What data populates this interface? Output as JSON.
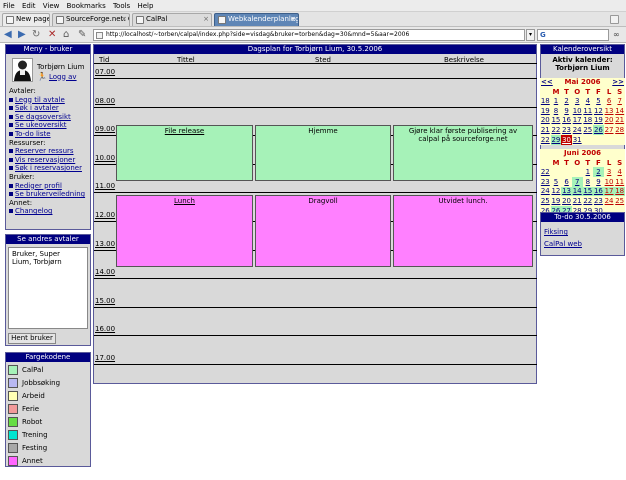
{
  "menu": [
    "File",
    "Edit",
    "View",
    "Bookmarks",
    "Tools",
    "Help"
  ],
  "tabs": [
    {
      "label": "New page"
    },
    {
      "label": "SourceForge.net: Cal..."
    },
    {
      "label": "CalPal"
    },
    {
      "label": "Webkalenderplanleg..."
    }
  ],
  "url": "http://localhost/~torben/calpal/index.php?side=visdag&bruker=torben&dag=30&mnd=5&aar=2006",
  "search_prefix": "G",
  "left": {
    "meny_title": "Meny - bruker",
    "user_name": "Torbjørn Lium",
    "logout": "Logg av",
    "groups": [
      {
        "title": "Avtaler:",
        "items": [
          "Legg til avtale",
          "Søk i avtaler",
          "Se dagsoversikt",
          "Se ukeoversikt",
          "To-do liste"
        ]
      },
      {
        "title": "Ressurser:",
        "items": [
          "Reserver ressurs",
          "Vis reservasjoner",
          "Søk i reservasjoner"
        ]
      },
      {
        "title": "Bruker:",
        "items": [
          "Rediger profil",
          "Se brukerveiledning"
        ]
      },
      {
        "title": "Annet:",
        "items": [
          "Changelog"
        ]
      }
    ],
    "others_title": "Se andres avtaler",
    "others_list": [
      "Bruker, Super",
      "Lium, Torbjørn"
    ],
    "fetch_button": "Hent bruker",
    "colors_title": "Fargekodene",
    "colors": [
      {
        "label": "CalPal",
        "color": "#a6f2b8"
      },
      {
        "label": "Jobbsøking",
        "color": "#b8b8f2"
      },
      {
        "label": "Arbeid",
        "color": "#ffffb4"
      },
      {
        "label": "Ferie",
        "color": "#f29a9a"
      },
      {
        "label": "Robot",
        "color": "#66dd44"
      },
      {
        "label": "Trening",
        "color": "#00e5d0"
      },
      {
        "label": "Festing",
        "color": "#a8a8a8"
      },
      {
        "label": "Annet",
        "color": "#ff66ff"
      }
    ]
  },
  "main": {
    "title": "Dagsplan for Torbjørn Lium, 30.5.2006",
    "columns": [
      "Tid",
      "Tittel",
      "Sted",
      "Beskrivelse"
    ],
    "hours": [
      "07.00",
      "08.00",
      "09.00",
      "10.00",
      "11.00",
      "12.00",
      "13.00",
      "14.00",
      "15.00",
      "16.00",
      "17.00"
    ],
    "events": [
      {
        "title": "File release",
        "place": "Hjemme",
        "desc": "Gjøre klar første publisering av calpal på sourceforge.net",
        "color": "#a6f2b8"
      },
      {
        "title": "Lunch",
        "place": "Dragvoll",
        "desc": "Utvidet lunch.",
        "color": "#ff80ff"
      }
    ]
  },
  "right": {
    "cal_title": "Kalenderoversikt",
    "active_label": "Aktiv kalender:",
    "active_name": "Torbjørn Lium",
    "prev": "<<",
    "next": ">>",
    "weekdays": [
      "M",
      "T",
      "O",
      "T",
      "F",
      "L",
      "S"
    ],
    "may_title": "Mai 2006",
    "may_weeks": [
      [
        "1",
        "2",
        "3",
        "4",
        "5",
        "6",
        "7"
      ],
      [
        "8",
        "9",
        "10",
        "11",
        "12",
        "13",
        "14"
      ],
      [
        "15",
        "16",
        "17",
        "18",
        "19",
        "20",
        "21"
      ],
      [
        "22",
        "23",
        "24",
        "25",
        "26",
        "27",
        "28"
      ],
      [
        "29",
        "30",
        "31",
        "",
        "",
        "",
        ""
      ]
    ],
    "may_weeknums": [
      "18",
      "19",
      "20",
      "21",
      "22"
    ],
    "june_title": "Juni 2006",
    "june_weeks": [
      [
        "",
        "",
        "",
        "1",
        "2",
        "3",
        "4"
      ],
      [
        "5",
        "6",
        "7",
        "8",
        "9",
        "10",
        "11"
      ],
      [
        "12",
        "13",
        "14",
        "15",
        "16",
        "17",
        "18"
      ],
      [
        "19",
        "20",
        "21",
        "22",
        "23",
        "24",
        "25"
      ],
      [
        "26",
        "27",
        "28",
        "29",
        "30",
        "",
        ""
      ]
    ],
    "june_weeknums": [
      "22",
      "23",
      "24",
      "25",
      "26"
    ],
    "todo_title": "To-do 30.5.2006",
    "todo_items": [
      "Fiksing",
      "CalPal web"
    ]
  }
}
